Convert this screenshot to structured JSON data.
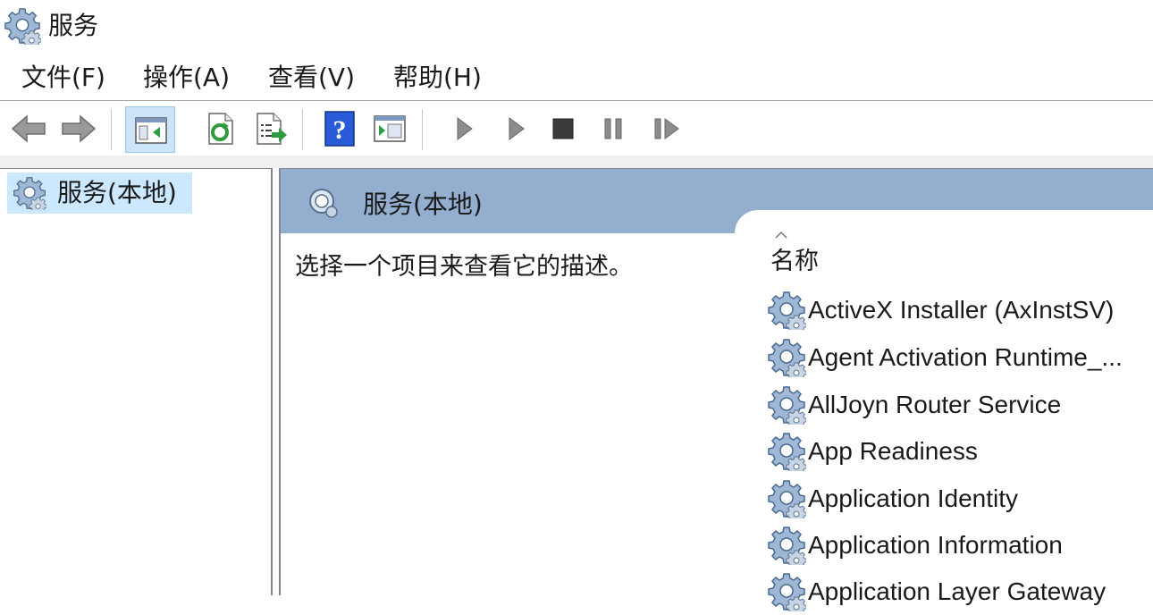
{
  "window": {
    "title": "服务"
  },
  "menu": {
    "items": [
      "文件(F)",
      "操作(A)",
      "查看(V)",
      "帮助(H)"
    ]
  },
  "toolbar": {
    "buttons": [
      "back-arrow-icon",
      "forward-arrow-icon",
      "show-hide-tree-icon",
      "refresh-icon",
      "export-list-icon",
      "help-icon",
      "console-view-icon",
      "start-service-icon",
      "start-service-alt-icon",
      "stop-service-icon",
      "pause-service-icon",
      "resume-service-icon"
    ]
  },
  "tree": {
    "root_label": "服务(本地)"
  },
  "main": {
    "header_title": "服务(本地)",
    "description": "选择一个项目来查看它的描述。",
    "column_name": "名称",
    "services": [
      "ActiveX Installer (AxInstSV)",
      "Agent Activation Runtime_...",
      "AllJoyn Router Service",
      "App Readiness",
      "Application Identity",
      "Application Information",
      "Application Layer Gateway"
    ]
  },
  "colors": {
    "header_bg": "#94aed0",
    "selection_bg": "#cce8ff",
    "toolbar_active_bg": "#cce4f7"
  }
}
